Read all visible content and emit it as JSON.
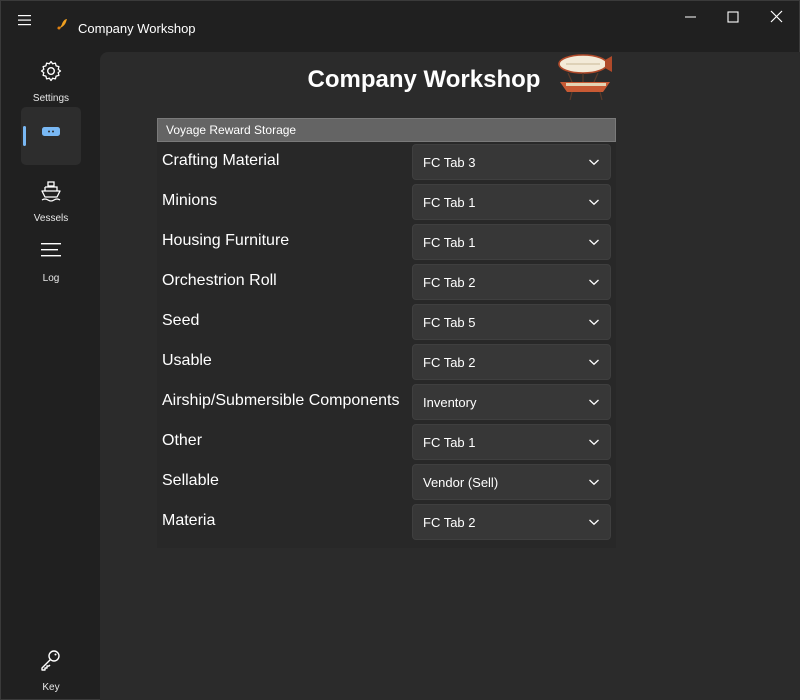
{
  "app": {
    "title": "Company Workshop"
  },
  "sidebar": {
    "items": [
      {
        "label": "Settings",
        "icon": "gear-icon"
      },
      {
        "label": "",
        "icon": "submarine-icon",
        "selected": true
      },
      {
        "label": "Vessels",
        "icon": "ship-icon"
      },
      {
        "label": "Log",
        "icon": "log-icon"
      },
      {
        "label": "Key",
        "icon": "key-icon"
      }
    ]
  },
  "main": {
    "page_title": "Company Workshop",
    "section_title": "Voyage Reward Storage",
    "rows": [
      {
        "label": "Crafting Material",
        "value": "FC Tab 3"
      },
      {
        "label": "Minions",
        "value": "FC Tab 1"
      },
      {
        "label": "Housing Furniture",
        "value": "FC Tab 1"
      },
      {
        "label": "Orchestrion Roll",
        "value": "FC Tab 2"
      },
      {
        "label": "Seed",
        "value": "FC Tab 5"
      },
      {
        "label": "Usable",
        "value": "FC Tab 2"
      },
      {
        "label": "Airship/Submersible Components",
        "value": "Inventory"
      },
      {
        "label": "Other",
        "value": "FC Tab 1"
      },
      {
        "label": "Sellable",
        "value": "Vendor (Sell)"
      },
      {
        "label": "Materia",
        "value": "FC Tab 2"
      }
    ]
  },
  "colors": {
    "accent": "#79b8f4",
    "window_bg": "#202020",
    "content_bg": "#2b2b2b",
    "header_bg": "#646464",
    "dropdown_bg": "#373737"
  }
}
